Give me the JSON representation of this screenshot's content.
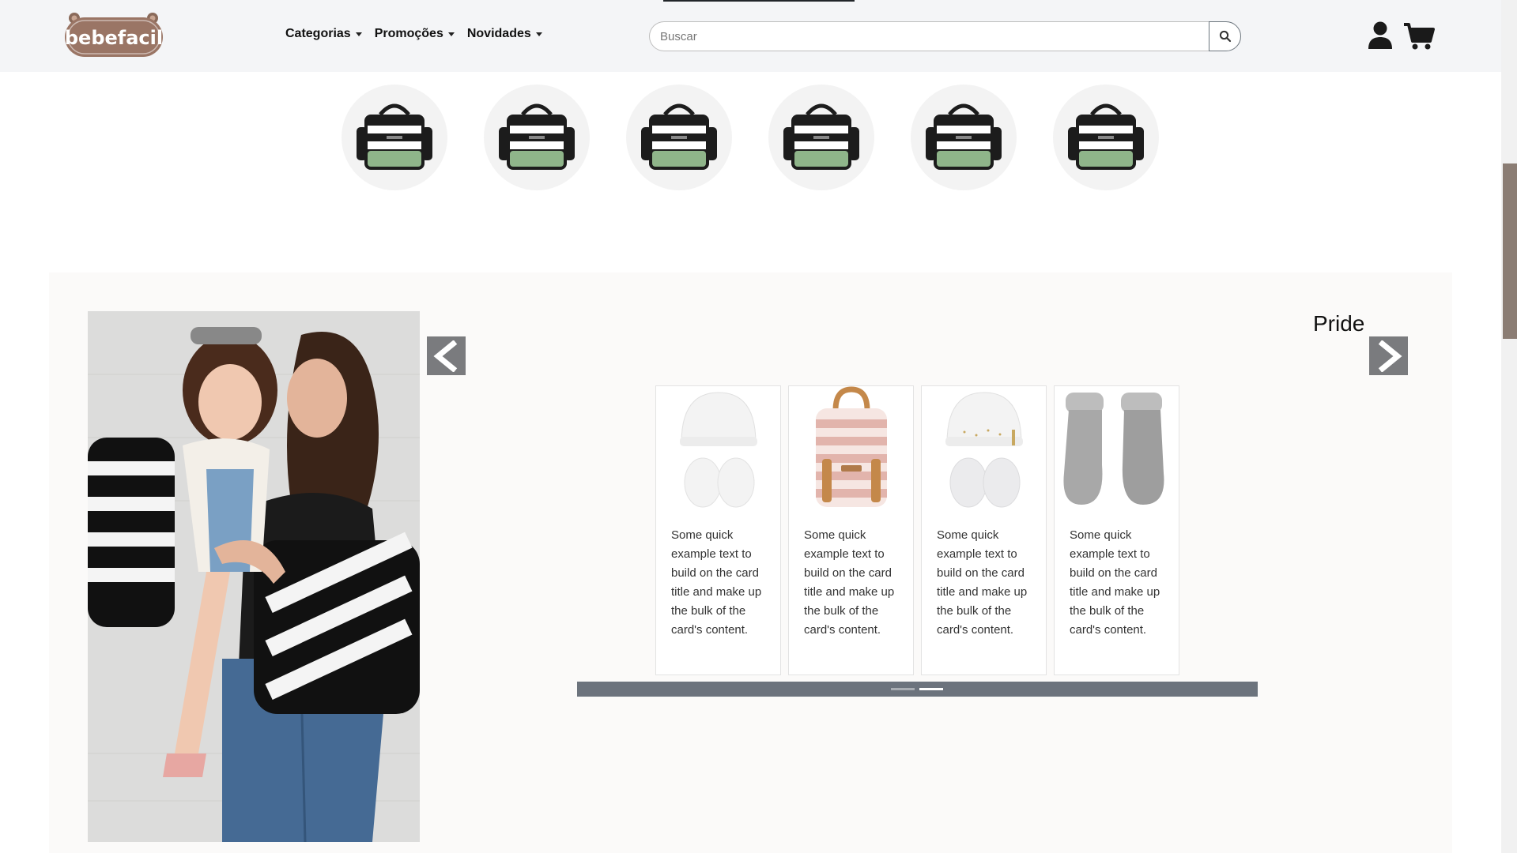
{
  "header": {
    "logo_text": "bebefacil",
    "nav": [
      {
        "label": "Categorias"
      },
      {
        "label": "Promoções"
      },
      {
        "label": "Novidades"
      }
    ],
    "search": {
      "placeholder": "Buscar",
      "value": ""
    },
    "icons": {
      "search": "search-icon",
      "user": "user-icon",
      "cart": "cart-icon"
    }
  },
  "circles": {
    "count": 6,
    "image": "diaper-bag-product"
  },
  "section": {
    "title": "Pride",
    "hero_image": "mother-carrying-child-with-striped-backpacks",
    "cards": [
      {
        "image": "white-hat-and-mittens",
        "text": "Some quick example text to build on the card title and make up the bulk of the card's content."
      },
      {
        "image": "pink-striped-backpack",
        "text": "Some quick example text to build on the card title and make up the bulk of the card's content."
      },
      {
        "image": "white-hat-and-mittens-set",
        "text": "Some quick example text to build on the card title and make up the bulk of the card's content."
      },
      {
        "image": "grey-baby-socks",
        "text": "Some quick example text to build on the card title and make up the bulk of the card's content."
      }
    ],
    "indicators": {
      "count": 2,
      "active_index": 1
    }
  },
  "colors": {
    "header_bg": "#f4f5f7",
    "section_bg": "#fbfaf9",
    "logo_brown": "#9a7565",
    "arrow_bg": "#7a7b7e",
    "indicator_bar": "#6c737d",
    "scroll_thumb": "#8b7d74"
  }
}
